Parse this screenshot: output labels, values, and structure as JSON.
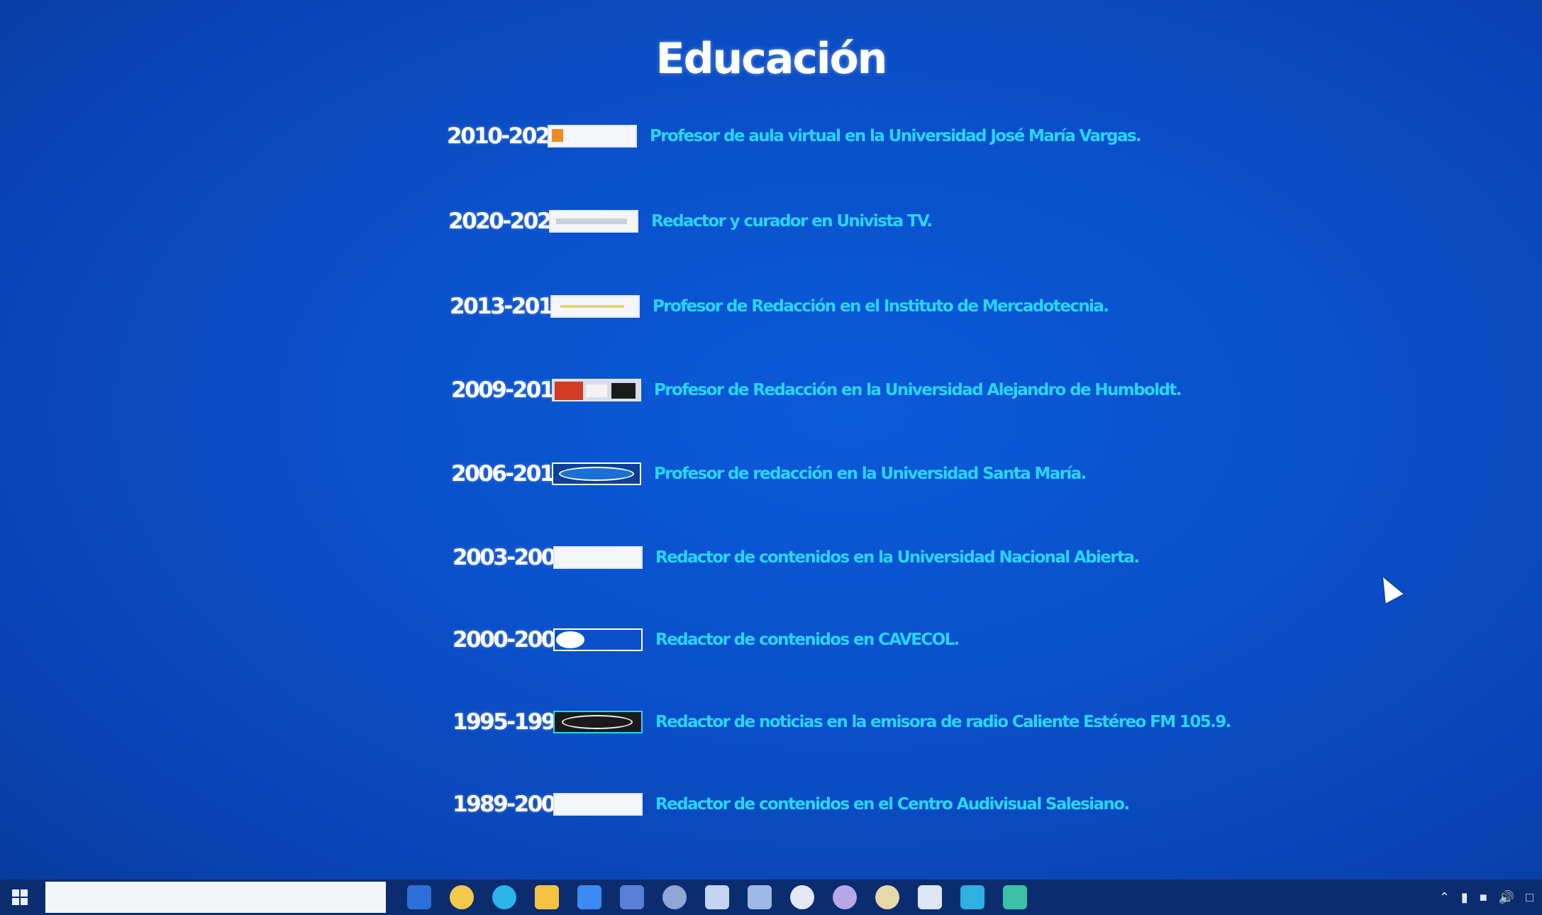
{
  "page": {
    "title": "Educación"
  },
  "entries": [
    {
      "years": "2010-2022",
      "text": "Profesor de aula virtual en la Universidad José María Vargas.",
      "logo": "university-jose-maria-vargas-logo"
    },
    {
      "years": "2020-2022",
      "text": "Redactor y curador en Univista TV.",
      "logo": "univista-tv-logo"
    },
    {
      "years": "2013-2016",
      "text": "Profesor de Redacción en el Instituto de Mercadotecnia.",
      "logo": "instituto-mercadotecnia-logo"
    },
    {
      "years": "2009-2016",
      "text": "Profesor de Redacción en la Universidad Alejandro de Humboldt.",
      "logo": "universidad-humboldt-logo"
    },
    {
      "years": "2006-2016",
      "text": "Profesor de redacción en la Universidad Santa María.",
      "logo": "universidad-santa-maria-logo"
    },
    {
      "years": "2003-2006",
      "text": "Redactor de contenidos en la Universidad Nacional Abierta.",
      "logo": "universidad-nacional-abierta-logo"
    },
    {
      "years": "2000-2002",
      "text": "Redactor de contenidos en CAVECOL.",
      "logo": "cavecol-logo"
    },
    {
      "years": "1995-1999",
      "text": "Redactor de noticias en la emisora de radio Caliente Estéreo FM 105.9.",
      "logo": "caliente-estereo-logo"
    },
    {
      "years": "1989-2000",
      "text": "Redactor de contenidos en el Centro Audivisual Salesiano.",
      "logo": "centro-audiovisual-salesiano-logo"
    }
  ],
  "colors": {
    "background": "#0a4fc9",
    "title": "#ffffff",
    "years": "#ffffff",
    "description": "#27d6ff",
    "taskbar": "#0b2c6e"
  },
  "taskbar": {
    "icons": [
      "file-explorer-icon",
      "browser-icon",
      "edge-icon",
      "folder-icon",
      "store-icon",
      "mail-icon",
      "media-icon",
      "document-icon",
      "app-icon",
      "app-icon",
      "app-icon",
      "app-icon",
      "app-icon",
      "app-icon",
      "app-icon"
    ]
  }
}
